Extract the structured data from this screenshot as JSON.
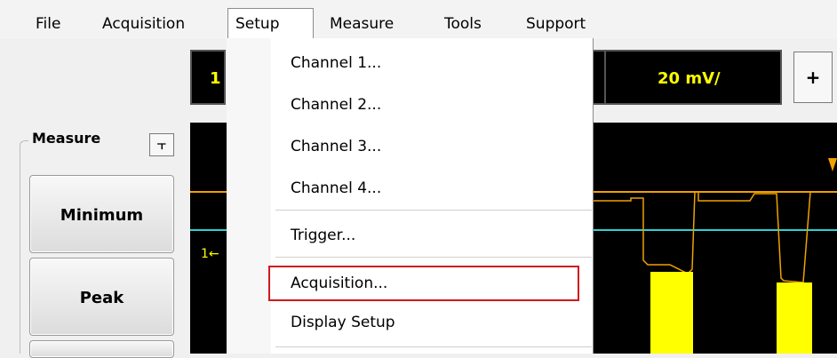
{
  "menubar": {
    "items": [
      "File",
      "Acquisition",
      "Setup",
      "Measure",
      "Tools",
      "Support"
    ],
    "active": "Setup"
  },
  "setup_menu": {
    "items": [
      "Channel 1...",
      "Channel 2...",
      "Channel 3...",
      "Channel 4...",
      "Trigger...",
      "Acquisition...",
      "Display Setup"
    ],
    "highlighted": "Acquisition..."
  },
  "toolbar": {
    "channel": "1",
    "scale": "20 mV/",
    "plus_label": "+"
  },
  "measure_panel": {
    "title": "Measure",
    "pin_icon": "⫟",
    "buttons": [
      "Minimum",
      "Peak"
    ]
  },
  "display": {
    "channel_marker": "1",
    "colors": {
      "trace": "#ffff00",
      "outline": "#f0a000",
      "cyan_line": "#30d0d0",
      "background": "#000000",
      "highlight": "#d0191e"
    }
  }
}
